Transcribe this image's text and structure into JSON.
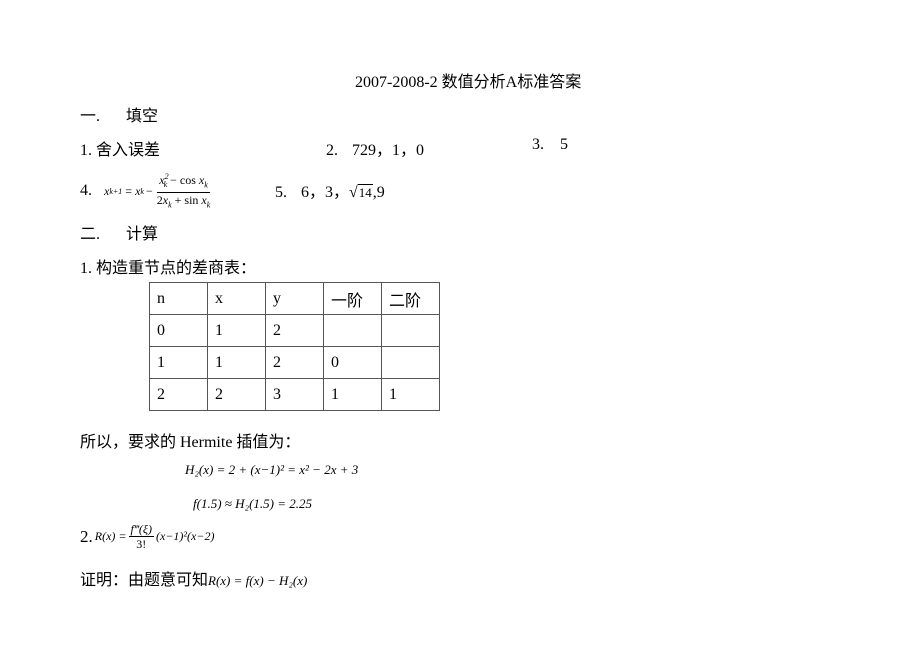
{
  "title": "2007-2008-2 数值分析A标准答案",
  "section1": {
    "heading_num": "一.",
    "heading": "填空",
    "answers": [
      {
        "num": "1.",
        "text": "舍入误差"
      },
      {
        "num": "2.",
        "text": "729，1，0"
      },
      {
        "num": "3.",
        "text": "5"
      },
      {
        "num": "4.",
        "lhs": "x",
        "lhs_sub": "k+1",
        "eq": "=",
        "x": "x",
        "k": "k",
        "minus": "−",
        "numerator": {
          "base": "x",
          "sub": "k",
          "sup": "2",
          "rest": "− cos ",
          "x": "x",
          "sub2": "k"
        },
        "denominator": {
          "coef": "2",
          "x": "x",
          "sub": "k",
          "rest": "+ sin ",
          "x2": "x",
          "sub2": "k"
        }
      },
      {
        "num": "5.",
        "text_before": "6，3，",
        "sqrt_arg": "14",
        "text_after": ",9"
      }
    ]
  },
  "section2": {
    "heading_num": "二.",
    "heading": "计算",
    "q1_label": "1. 构造重节点的差商表：",
    "table": {
      "headers": [
        "n",
        "x",
        "y",
        "一阶",
        "二阶"
      ],
      "rows": [
        [
          "0",
          "1",
          "2",
          "",
          ""
        ],
        [
          "1",
          "1",
          "2",
          "0",
          ""
        ],
        [
          "2",
          "2",
          "3",
          "1",
          "1"
        ]
      ]
    },
    "conclusion": "所以，要求的 Hermite 插值为：",
    "formula1": "H₂(x) = 2 + (x−1)² = x² − 2x + 3",
    "formula2": "f(1.5) ≈ H₂(1.5) = 2.25",
    "q2_num": "2.",
    "q2_lhs": "R(x) =",
    "q2_frac_num": "f‴(ξ)",
    "q2_frac_den": "3!",
    "q2_rest": "(x−1)²(x−2)",
    "proof_label": "证明：由题意可知",
    "proof_formula": "R(x) = f(x) − H₂(x)"
  }
}
